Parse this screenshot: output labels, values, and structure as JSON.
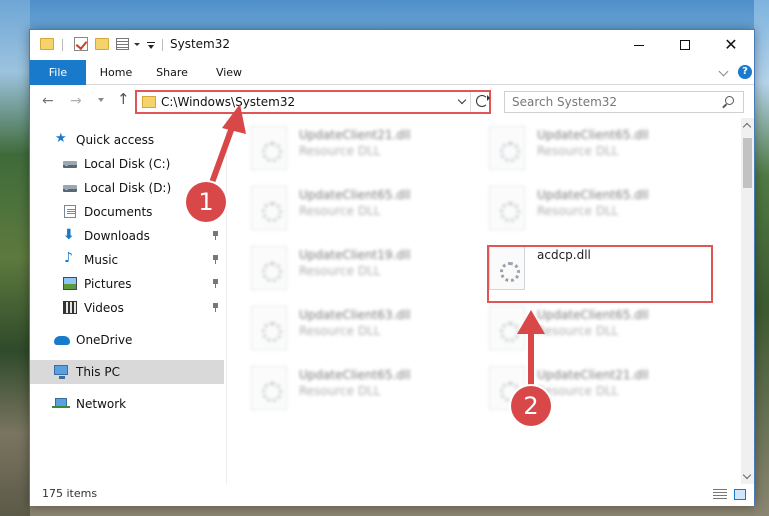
{
  "window": {
    "title": "System32",
    "item_count": "175 items"
  },
  "ribbon": {
    "tabs": [
      "File",
      "Home",
      "Share",
      "View"
    ],
    "help": "?"
  },
  "address": {
    "path": "C:\\Windows\\System32",
    "search_placeholder": "Search System32"
  },
  "nav": {
    "quick_access": "Quick access",
    "local_c": "Local Disk (C:)",
    "local_d": "Local Disk (D:)",
    "documents": "Documents",
    "downloads": "Downloads",
    "music": "Music",
    "pictures": "Pictures",
    "videos": "Videos",
    "onedrive": "OneDrive",
    "this_pc": "This PC",
    "network": "Network"
  },
  "files": [
    {
      "name": "UpdateClient21.dll",
      "type": "Resource DLL"
    },
    {
      "name": "UpdateClient65.dll",
      "type": "Resource DLL"
    },
    {
      "name": "UpdateClient65.dll",
      "type": "Resource DLL"
    },
    {
      "name": "UpdateClient65.dll",
      "type": "Resource DLL"
    },
    {
      "name": "UpdateClient19.dll",
      "type": "Resource DLL"
    },
    {
      "name": "acdcp.dll",
      "type": ""
    },
    {
      "name": "UpdateClient63.dll",
      "type": "Resource DLL"
    },
    {
      "name": "UpdateClient65.dll",
      "type": "Resource DLL"
    },
    {
      "name": "UpdateClient65.dll",
      "type": "Resource DLL"
    },
    {
      "name": "UpdateClient21.dll",
      "type": "Resource DLL"
    }
  ],
  "annotations": {
    "step1": "1",
    "step2": "2",
    "marker_color": "#d94848"
  },
  "colors": {
    "accent": "#1979ca",
    "highlight": "#e05555"
  }
}
